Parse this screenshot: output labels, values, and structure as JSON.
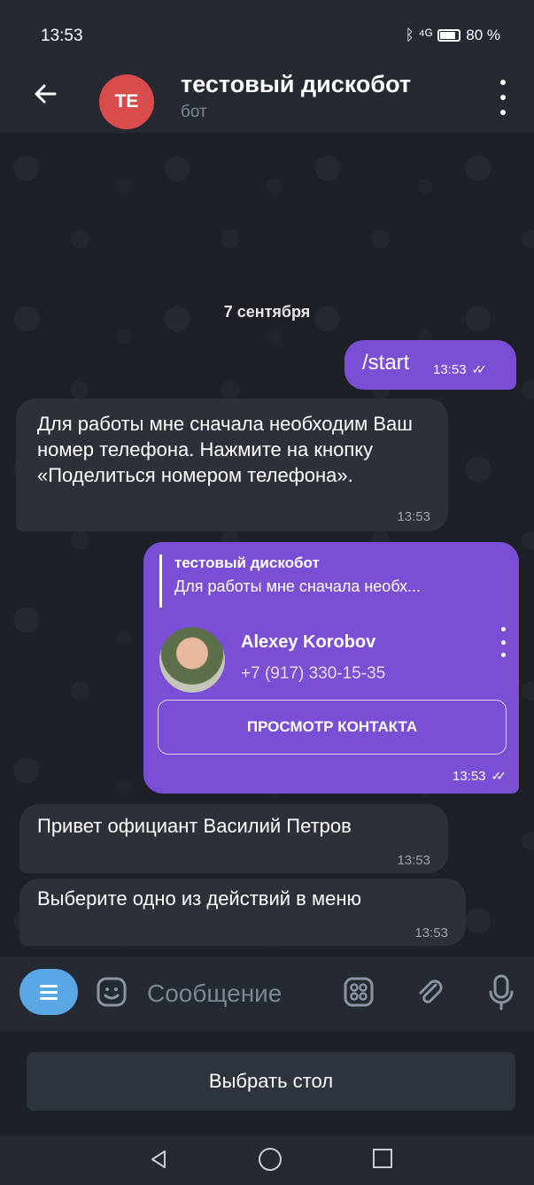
{
  "status_bar": {
    "time": "13:53",
    "net_icons": "ᛒ ⁴ᴳ",
    "battery": "80 %"
  },
  "header": {
    "avatar_initials": "TE",
    "title": "тестовый дискобот",
    "subtitle": "бот"
  },
  "chat": {
    "date": "7 сентября",
    "messages": [
      {
        "direction": "out",
        "text": "/start",
        "time": "13:53"
      },
      {
        "direction": "in",
        "text": "Для работы мне сначала необходим Ваш номер телефона. Нажмите на кнопку «Поделиться номером телефона».",
        "time": "13:53"
      },
      {
        "direction": "out",
        "reply": {
          "name": "тестовый дискобот",
          "text": "Для работы мне сначала необх..."
        },
        "contact": {
          "name": "Alexey Korobov",
          "phone": "+7 (917) 330-15-35",
          "button": "ПРОСМОТР КОНТАКТА"
        },
        "time": "13:53"
      },
      {
        "direction": "in",
        "text": "Привет официант Василий Петров",
        "time": "13:53"
      },
      {
        "direction": "in",
        "text": "Выберите одно из действий в меню",
        "time": "13:53"
      }
    ]
  },
  "input": {
    "placeholder": "Сообщение"
  },
  "keyboard": {
    "button": "Выбрать стол"
  },
  "colors": {
    "outgoing": "#7a4fd6",
    "incoming": "#2c3038",
    "menu_button": "#5aa7e6",
    "avatar": "#d94c4c"
  }
}
